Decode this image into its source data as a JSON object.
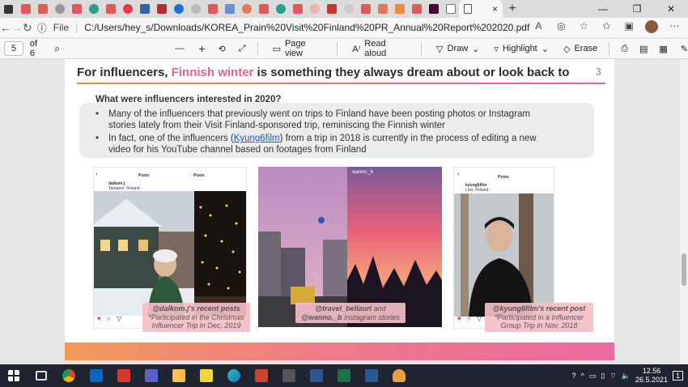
{
  "browser": {
    "url": "C:/Users/hey_s/Downloads/KOREA_Prain%20Visit%20Finland%20PR_Annual%20Report%202020.pdf",
    "url_scheme": "File",
    "tab_close": "×",
    "new_tab": "+"
  },
  "pdf_toolbar": {
    "page_current": "5",
    "page_total": "of 6",
    "zoom_out": "—",
    "zoom_in": "+",
    "page_view": "Page view",
    "read_aloud": "Read aloud",
    "draw": "Draw",
    "highlight": "Highlight",
    "erase": "Erase"
  },
  "slide": {
    "title_pre": "For influencers, ",
    "title_highlight": "Finnish winter",
    "title_post": " is something they always dream about or look back to",
    "page_number": "3",
    "question": "What were influencers interested in 2020?",
    "bullet1": "Many of the influencers that previously went on trips to Finland have been posting photos or Instagram stories lately from their Visit Finland-sponsored trip, reminiscing the Finnish winter",
    "bullet2_pre": "In fact, one of the influencers (",
    "bullet2_link": "Kyung6film",
    "bullet2_post": ") from a trip in 2018 is currently in the process of editing a new video for his YouTube channel based on footages from Finland",
    "bullet_mark": "•"
  },
  "photos": {
    "cap1_title": "@dalkom.j's recent posts",
    "cap1_sub": "*Participated in the Christmas Influencer Trip in Dec, 2019",
    "cap2_title": "@travel_bellauri",
    "cap2_and": "and",
    "cap2_title2": "@wanno._b",
    "cap2_sub": "Instagram stories",
    "cap3_title": "@kyung6film's recent post",
    "cap3_sub": "*Participated in a Influencer Group Trip in Nov, 2018",
    "ig1_posts": "Posts",
    "ig1_user": "dalkom.j",
    "ig1_place": "Tampere, Finland",
    "ig2_posts": "Posts",
    "ig3_posts": "Posts",
    "ig3_user": "kyung6film",
    "ig3_place": "Levi, Finland",
    "story_user": "wanno._b"
  },
  "taskbar": {
    "time": "12.56",
    "date": "26.5.2021",
    "notif_count": "1"
  }
}
